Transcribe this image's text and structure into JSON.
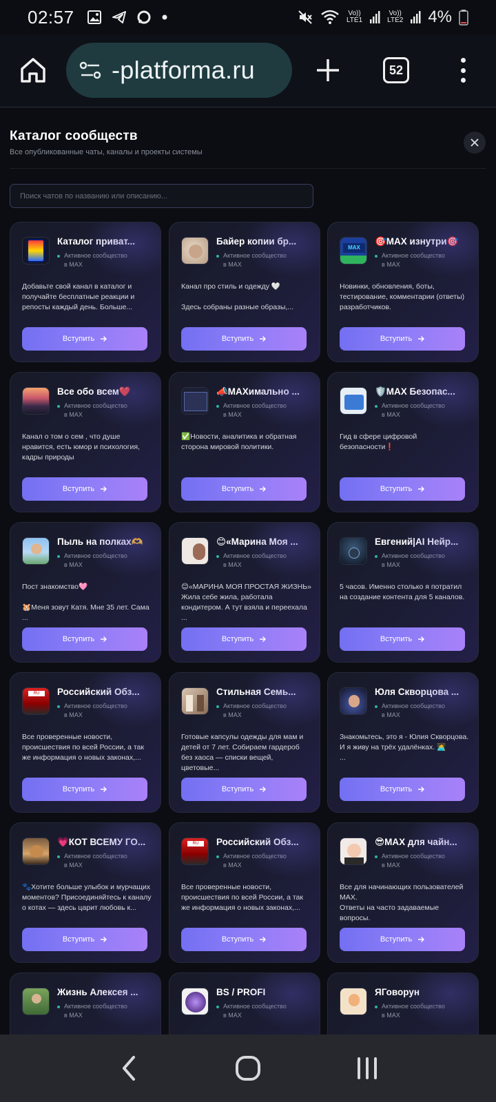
{
  "status_bar": {
    "time": "02:57",
    "sim1": [
      "Vo))",
      "LTE1"
    ],
    "sim2": [
      "Vo))",
      "LTE2"
    ],
    "battery": "4%"
  },
  "browser": {
    "url": "-platforma.ru",
    "tab_count": "52"
  },
  "page": {
    "title": "Каталог сообществ",
    "subtitle": "Все опубликованные чаты, каналы и проекты системы",
    "search_placeholder": "Поиск чатов по названию или описанию..."
  },
  "status_text": [
    "Активное сообщество",
    "в MAX"
  ],
  "join_label": "Вступить",
  "cards": [
    {
      "name": "Каталог приват...",
      "desc": "Добавьте свой канал в каталог и получайте бесплатные реакции и репосты каждый день. Больше...",
      "avatar": "catalog"
    },
    {
      "name": "Байер копии бр...",
      "desc": "Канал про стиль и одежду 🤍\n\nЗдесь собраны разные образы,...",
      "avatar": "bayer"
    },
    {
      "name": "🎯MAX изнутри🎯",
      "desc": "Новинки, обновления, боты, тестирование, комментарии (ответы) разработчиков.",
      "avatar": "max-inside"
    },
    {
      "name": "Все обо всем❤️",
      "desc": "Канал о том о сем , что душе нравится, есть юмор и психология, кадры природы",
      "avatar": "sunset"
    },
    {
      "name": "📣MAXимально ...",
      "desc": "✅Новости, аналитика и обратная сторона мировой политики.",
      "avatar": "maximalno"
    },
    {
      "name": "🛡️MAX Безопас...",
      "desc": "Гид в сфере цифровой безопасности❗",
      "avatar": "security"
    },
    {
      "name": "Пыль на полках🫶",
      "desc": "Пост знакомство🩷\n\n🐹Меня зовут Катя. Мне 35 лет. Сама ...",
      "avatar": "dust"
    },
    {
      "name": "😊«Марина Моя ...",
      "desc": "😊«МАРИНА МОЯ ПРОСТАЯ ЖИЗНЬ» Жила себе жила, работала кондитером. А тут взяла и переехала ...",
      "avatar": "marina"
    },
    {
      "name": "Евгений|AI Нейр...",
      "desc": "5 часов. Именно столько я потратил на создание контента для 5 каналов.",
      "avatar": "evgeny"
    },
    {
      "name": "Российский Обз...",
      "desc": "Все проверенные новости, происшествия по всей России, а так же информация о новых законах,...",
      "avatar": "russia"
    },
    {
      "name": "Стильная Семь...",
      "desc": "Готовые капсулы одежды для мам и детей от 7 лет. Собираем гардероб без хаоса — списки вещей, цветовые...",
      "avatar": "stylish"
    },
    {
      "name": "Юля Скворцова ...",
      "desc": "Знакомьтесь, это я - Юлия Скворцова. И я живу на трёх удалёнках. 👩‍💻\n...",
      "avatar": "yulia"
    },
    {
      "name": "💗КОТ ВСЕМУ ГО...",
      "desc": "🐾Хотите больше улыбок и мурчащих моментов? Присоединяйтесь к каналу о котах — здесь царит любовь к...",
      "avatar": "cat"
    },
    {
      "name": "Российский Обз...",
      "desc": "Все проверенные новости, происшествия по всей России, а так же информация о новых законах,...",
      "avatar": "russia"
    },
    {
      "name": "😎MAX для чайн...",
      "desc": "Все для начинающих пользователей MAX.\nОтветы на часто задаваемые вопросы.",
      "avatar": "teapot"
    },
    {
      "name": "Жизнь Алексея ...",
      "desc": "",
      "avatar": "alexey"
    },
    {
      "name": "BS / PROFI",
      "desc": "",
      "avatar": "bsprofi"
    },
    {
      "name": "ЯГоворун",
      "desc": "",
      "avatar": "govorun"
    }
  ]
}
